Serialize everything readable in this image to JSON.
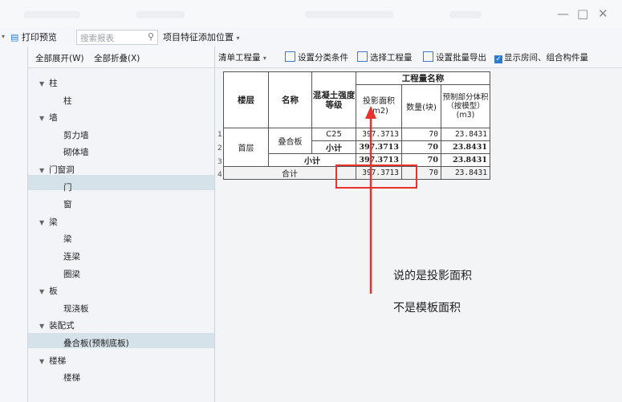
{
  "window": {
    "minimize": "—",
    "maximize": "□",
    "close": "✕"
  },
  "toolbar": {
    "print_preview": "打印预览",
    "search_placeholder": "搜索报表",
    "feature_position": "项目特征添加位置"
  },
  "tree": {
    "expand_all": "全部展开(W)",
    "collapse_all": "全部折叠(X)",
    "nodes": [
      {
        "label": "柱",
        "level": 0
      },
      {
        "label": "柱",
        "level": 1
      },
      {
        "label": "墙",
        "level": 0
      },
      {
        "label": "剪力墙",
        "level": 1
      },
      {
        "label": "砌体墙",
        "level": 1
      },
      {
        "label": "门窗洞",
        "level": 0
      },
      {
        "label": "门",
        "level": 1
      },
      {
        "label": "窗",
        "level": 1
      },
      {
        "label": "梁",
        "level": 0
      },
      {
        "label": "梁",
        "level": 1
      },
      {
        "label": "连梁",
        "level": 1
      },
      {
        "label": "圈梁",
        "level": 1
      },
      {
        "label": "板",
        "level": 0
      },
      {
        "label": "现浇板",
        "level": 1
      },
      {
        "label": "装配式",
        "level": 0
      },
      {
        "label": "叠合板(预制底板)",
        "level": 1
      },
      {
        "label": "楼梯",
        "level": 0
      },
      {
        "label": "楼梯",
        "level": 1
      }
    ]
  },
  "report_toolbar": {
    "bill_quantity": "清单工程量",
    "set_category": "设置分类条件",
    "select_quantity": "选择工程量",
    "batch_export": "设置批量导出",
    "show_rooms": "显示房间、组合构件量"
  },
  "table": {
    "headers": {
      "floor": "楼层",
      "name": "名称",
      "concrete_grade": "混凝土强度等级",
      "quantity_group": "工程量名称",
      "projected_area": "投影面积(m2)",
      "count": "数量(块)",
      "prefab_volume": "预制部分体积（按模型）(m3)"
    },
    "row_numbers": [
      "1",
      "2",
      "3",
      "4"
    ],
    "floor": "首层",
    "name": "叠合板",
    "grade": "C25",
    "subtotal": "小计",
    "total": "合计",
    "rows": [
      {
        "area": "397.3713",
        "count": "70",
        "volume": "23.8431"
      },
      {
        "area": "397.3713",
        "count": "70",
        "volume": "23.8431"
      },
      {
        "area": "397.3713",
        "count": "70",
        "volume": "23.8431"
      },
      {
        "area": "397.3713",
        "count": "70",
        "volume": "23.8431"
      }
    ]
  },
  "annotation": {
    "line1": "说的是投影面积",
    "line2": "不是模板面积",
    "color": "#e8322e"
  }
}
